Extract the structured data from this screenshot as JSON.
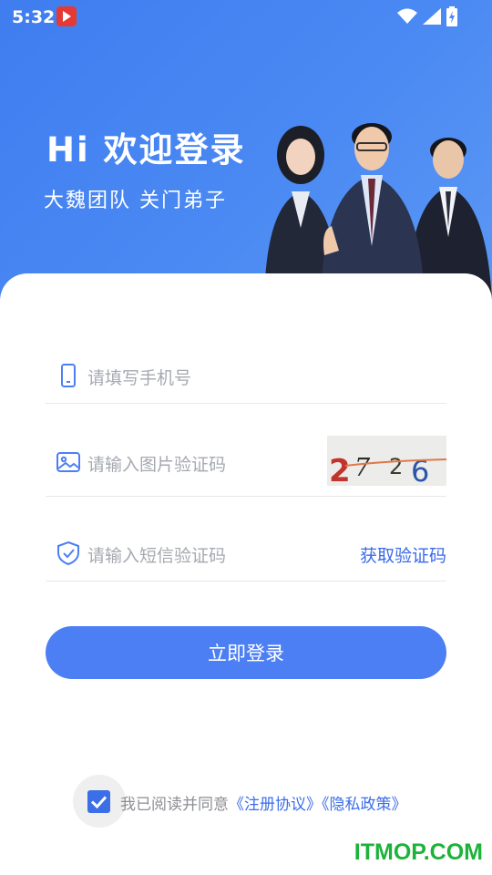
{
  "status_bar": {
    "time": "5:32"
  },
  "hero": {
    "title": "Hi 欢迎登录",
    "subtitle": "大魏团队  关门弟子"
  },
  "form": {
    "phone_placeholder": "请填写手机号",
    "image_code_placeholder": "请输入图片验证码",
    "captcha_text": "2726",
    "sms_code_placeholder": "请输入短信验证码",
    "get_code_label": "获取验证码",
    "login_label": "立即登录"
  },
  "agreement": {
    "prefix": "我已阅读并同意",
    "register_link": "《注册协议》",
    "privacy_link": "《隐私政策》",
    "checked": true
  },
  "watermark": "ITMOP.COM",
  "colors": {
    "primary": "#4d7ff4",
    "link": "#3b6ae8",
    "hero_bg": "#4a89f3",
    "watermark": "#1db33b"
  }
}
